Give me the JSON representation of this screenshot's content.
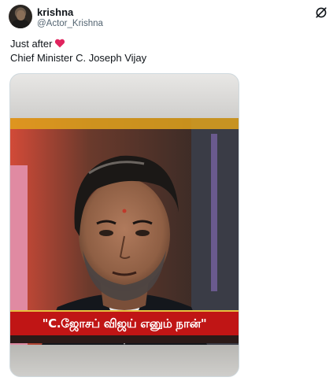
{
  "user": {
    "display_name": "krishna",
    "handle": "@Actor_Krishna"
  },
  "icons": {
    "avatar": "profile-photo",
    "menu": "grok-slash-circle-icon",
    "heart": "red-heart-emoji"
  },
  "tweet": {
    "line1": "Just after",
    "line2": "Chief Minister C. Joseph Vijay"
  },
  "media": {
    "caption": "\"C.ஜோசப் விஜய் எனும் நான்\""
  },
  "colors": {
    "heart": "#e0245e",
    "caption_bg": "#c01515",
    "text": "#0f1419",
    "muted": "#536471"
  }
}
